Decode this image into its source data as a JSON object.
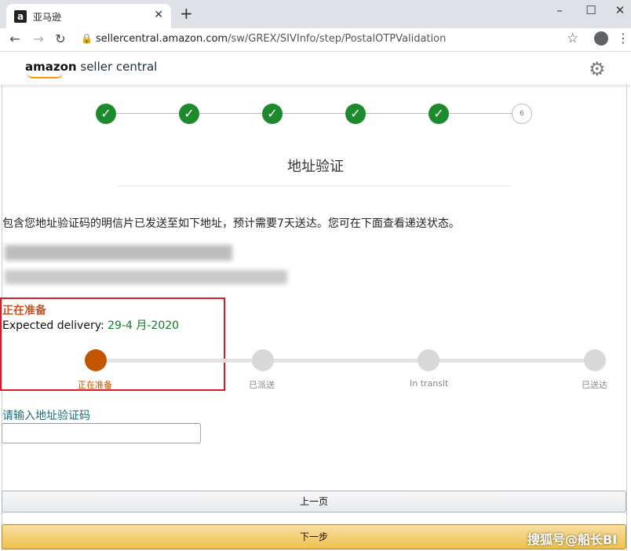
{
  "browser": {
    "tab_title": "亚马逊",
    "favicon": "a",
    "url_host": "sellercentral.amazon.com",
    "url_path": "/sw/GREX/SIVInfo/step/PostalOTPValidation",
    "icons": [
      "back-arrow-icon",
      "forward-arrow-icon",
      "reload-icon",
      "lock-icon",
      "star-icon",
      "profile-icon",
      "menu-icon"
    ]
  },
  "header": {
    "logo_brand": "amazon",
    "logo_product": "seller central",
    "settings_icon": "gear-icon"
  },
  "steps": {
    "completed": 5,
    "current_label": "6"
  },
  "page": {
    "title": "地址验证",
    "notice": "包含您地址验证码的明信片已发送至如下地址，预计需要7天送达。您可在下面查看递送状态。"
  },
  "tracking": {
    "status": "正在准备",
    "expected_label": "Expected delivery:",
    "expected_date": "29-4 月-2020",
    "stages": [
      "正在准备",
      "已派送",
      "In transit",
      "已送达"
    ],
    "active_stage": 0,
    "colors": {
      "active": "#c45500",
      "highlight_box": "#d7192a"
    }
  },
  "form": {
    "code_label": "请输入地址验证码",
    "code_value": ""
  },
  "buttons": {
    "prev": "上一页",
    "next": "下一步"
  },
  "watermark": "搜狐号@船长BI"
}
